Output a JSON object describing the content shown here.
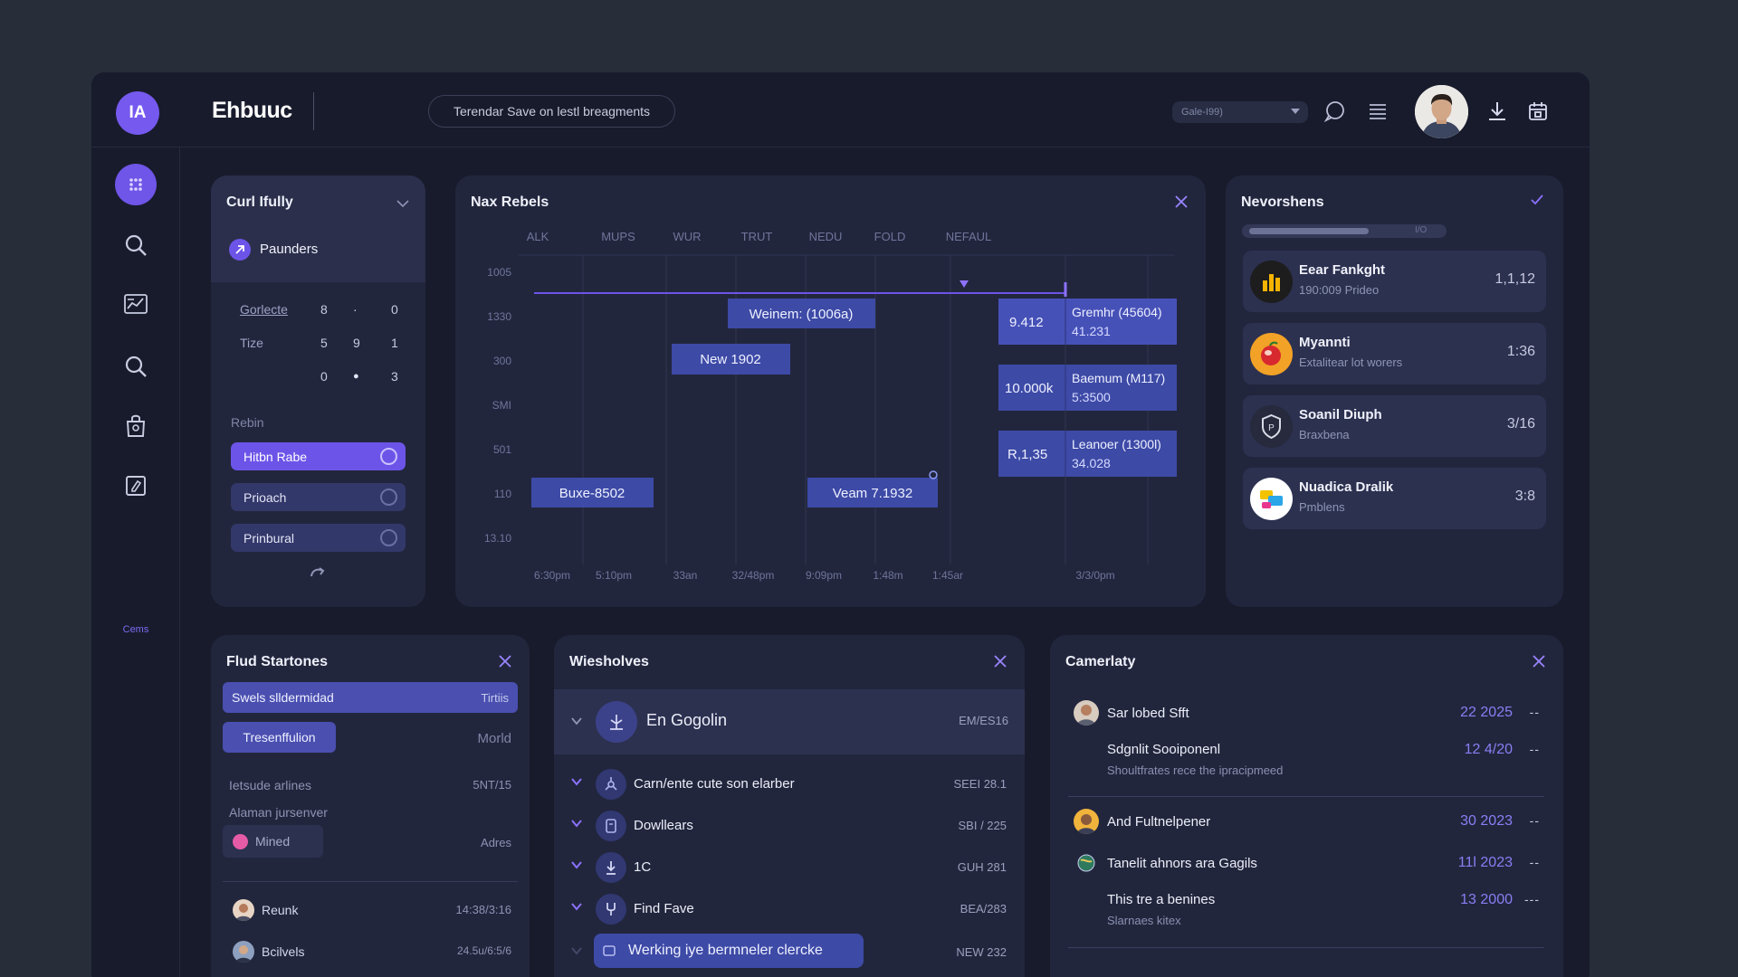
{
  "header": {
    "logo": "IA",
    "title": "Ehbuuc",
    "search_text": "Terendar Save on lestl breagments",
    "select_value": "Gale-I99)"
  },
  "rail": {
    "items": [
      "grid-icon",
      "search-icon",
      "chart-icon",
      "search-icon",
      "bag-icon",
      "edit-icon"
    ],
    "bottom_label": "Cems"
  },
  "card_curl": {
    "title": "Curl Ifully",
    "selected": "Paunders",
    "table": {
      "rows": [
        {
          "label": "Gorlecte",
          "values": [
            "8",
            "·",
            "0"
          ]
        },
        {
          "label": "Tize",
          "values": [
            "5",
            "9",
            "1"
          ]
        },
        {
          "label": "",
          "values": [
            "0",
            "●",
            "3"
          ]
        }
      ]
    },
    "section_label": "Rebin",
    "options": [
      {
        "label": "Hitbn Rabe",
        "on": true
      },
      {
        "label": "Prioach",
        "on": false
      },
      {
        "label": "Prinbural",
        "on": false
      }
    ]
  },
  "chart_card": {
    "title": "Nax Rebels",
    "columns": [
      "ALK",
      "MUPS",
      "WUR",
      "TRUT",
      "NEDU",
      "FOLD",
      "NEFAUL"
    ],
    "y_labels": [
      "1005",
      "1330",
      "300",
      "SMI",
      "501",
      "110",
      "13.10"
    ],
    "x_labels": [
      "6:30pm",
      "5:10pm",
      "33an",
      "32/48pm",
      "9:09pm",
      "1:48m",
      "1:45ar",
      "3/3/0pm"
    ],
    "bars": [
      {
        "label": "Weinem: (1006a)"
      },
      {
        "label": "New 1902"
      },
      {
        "label": "Buxe-8502"
      },
      {
        "label": "Veam 7.1932"
      }
    ],
    "right_blocks": [
      {
        "left": "9.412",
        "name": "Gremhr (45604)",
        "sub": "41.231"
      },
      {
        "left": "10.000k",
        "name": "Baemum (M117)",
        "sub": "5:3500"
      },
      {
        "left": "R,1,35",
        "name": "Leanoer (1300l)",
        "sub": "34.028"
      }
    ]
  },
  "nevorshens": {
    "title": "Nevorshens",
    "progress_label": "I/O",
    "progress": 0.75,
    "items": [
      {
        "name": "Eear Fankght",
        "sub": "190:009 Prideo",
        "value": "1,1,12"
      },
      {
        "name": "Myannti",
        "sub": "Extalitear lot worers",
        "value": "1:36"
      },
      {
        "name": "Soanil Diuph",
        "sub": "Braxbena",
        "value": "3/16"
      },
      {
        "name": "Nuadica Dralik",
        "sub": "Pmblens",
        "value": "3:8"
      }
    ]
  },
  "flud": {
    "title": "Flud Startones",
    "row1_label": "Swels slldermidad",
    "row1_right": "Tirtiis",
    "row2_label": "Tresenffulion",
    "row2_right": "Morld",
    "text1": "Ietsude arlines",
    "text1_right": "5NT/15",
    "text2": "Alaman jursenver",
    "chip": "Mined",
    "chip_right": "Adres",
    "people": [
      {
        "name": "Reunk",
        "time": "14:38/3:16"
      },
      {
        "name": "Bcilvels",
        "time": "24.5u/6:5/6"
      }
    ]
  },
  "wiesholves": {
    "title": "Wiesholves",
    "head_label": "En Gogolin",
    "head_code": "EM/ES16",
    "rows": [
      {
        "label": "Carn/ente cute son elarber",
        "code": "SEEI 28.1"
      },
      {
        "label": "Dowllears",
        "code": "SBI / 225"
      },
      {
        "label": "1C",
        "code": "GUH 281"
      },
      {
        "label": "Find Fave",
        "code": "BEA/283"
      }
    ],
    "footer_label": "Werking iye bermneler clercke",
    "footer_code": "NEW 232"
  },
  "camerlaty": {
    "title": "Camerlaty",
    "rows": [
      {
        "title": "Sar lobed Sfft",
        "sub": "",
        "date": "22 2025"
      },
      {
        "title": "Sdgnlit Sooiponenl",
        "sub": "Shoultfrates rece the ipracipmeed",
        "date": "12 4/20"
      },
      {
        "title": "And Fultnelpener",
        "sub": "",
        "date": "30 2023"
      },
      {
        "title": "Tanelit ahnors ara Gagils",
        "sub": "",
        "date": "11l 2023"
      },
      {
        "title": "This tre a benines",
        "sub": "Slarnaes kitex",
        "date": "13 2000"
      }
    ]
  },
  "colors": {
    "accent": "#6d54e8",
    "card": "#22263d",
    "bg": "#272e3a",
    "app": "#181b2c",
    "bar": "#3d4aa6",
    "date": "#8b7df4"
  }
}
